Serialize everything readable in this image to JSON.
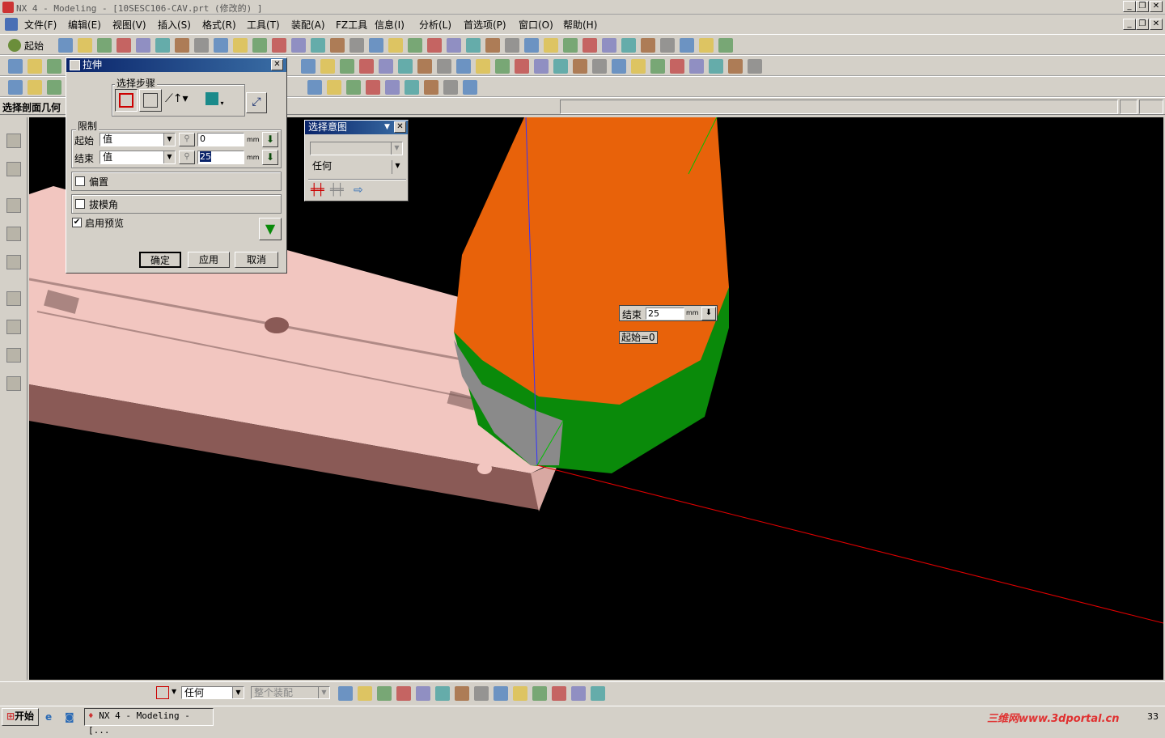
{
  "window": {
    "title": "NX 4 - Modeling - [10SESC106-CAV.prt (修改的) ]"
  },
  "menu": [
    "文件(F)",
    "编辑(E)",
    "视图(V)",
    "插入(S)",
    "格式(R)",
    "工具(T)",
    "装配(A)",
    "FZ工具",
    "信息(I)",
    "分析(L)",
    "首选项(P)",
    "窗口(O)",
    "帮助(H)"
  ],
  "toolbar": {
    "start_label": "起始"
  },
  "cue_line": "选择剖面几何",
  "extrude_dialog": {
    "title": "拉伸",
    "steps_label": "选择步骤",
    "limits_label": "限制",
    "start_label": "起始",
    "start_type": "值",
    "start_value": "0",
    "start_unit": "mm",
    "end_label": "结束",
    "end_type": "值",
    "end_value": "25",
    "end_unit": "mm",
    "offset_label": "偏置",
    "draft_label": "拔模角",
    "preview_label": "启用预览",
    "preview_checked": true,
    "ok_label": "确定",
    "apply_label": "应用",
    "cancel_label": "取消"
  },
  "intent_dialog": {
    "title": "选择意图",
    "filter_value": "任何"
  },
  "viewport_labels": {
    "end_label": "结束",
    "end_value": "25",
    "end_unit": "mm",
    "start_tag": "起始=0"
  },
  "bottom_toolbar": {
    "filter_value": "任何",
    "scope_value": "整个装配"
  },
  "taskbar": {
    "start_label": "开始",
    "task_label": "NX 4 - Modeling - [...",
    "watermark": "三维网www.3dportal.cn",
    "clock": "33"
  },
  "colors": {
    "viewport_bg": "#000000",
    "part_pink": "#f2c6c0",
    "cone_orange": "#e8620a",
    "cone_green": "#0a8a0a",
    "title_gradient_start": "#0a246a"
  }
}
